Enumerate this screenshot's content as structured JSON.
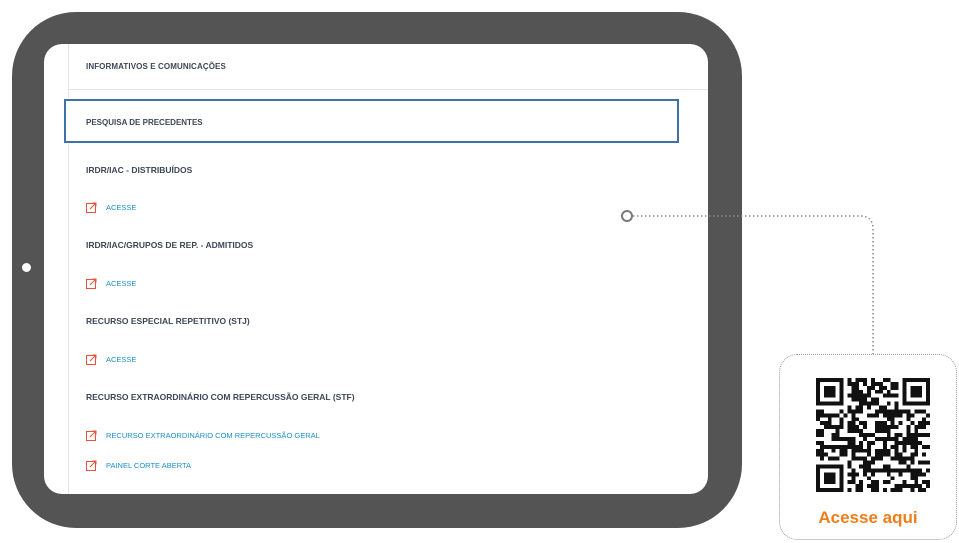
{
  "menu": {
    "informativos": "INFORMATIVOS E COMUNICAÇÕES",
    "pesquisa": "PESQUISA DE PRECEDENTES"
  },
  "sections": [
    {
      "title": "IRDR/IAC - DISTRIBUÍDOS",
      "links": [
        "ACESSE"
      ]
    },
    {
      "title": "IRDR/IAC/GRUPOS DE REP. - ADMITIDOS",
      "links": [
        "ACESSE"
      ]
    },
    {
      "title": "RECURSO ESPECIAL REPETITIVO (STJ)",
      "links": [
        "ACESSE"
      ]
    },
    {
      "title": "RECURSO EXTRAORDINÁRIO COM REPERCUSSÃO GERAL (STF)",
      "links": [
        "RECURSO EXTRAORDINÁRIO COM REPERCUSSÃO GERAL",
        "PAINEL CORTE ABERTA"
      ]
    }
  ],
  "qr": {
    "caption": "Acesse aqui"
  },
  "colors": {
    "link": "#1a8fc9",
    "link_icon": "#e5533d",
    "highlight_border": "#3f72a6",
    "tablet": "#545454",
    "caption": "#ef7d1a"
  },
  "icons": {
    "link": "external-link-icon",
    "qr": "qr-code-icon"
  }
}
